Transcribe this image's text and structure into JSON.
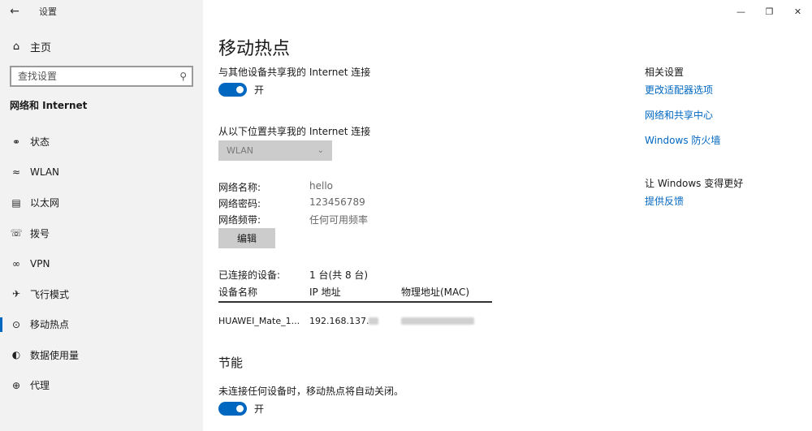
{
  "window": {
    "title": "设置"
  },
  "sidebar": {
    "home_label": "主页",
    "search_placeholder": "查找设置",
    "section_title": "网络和 Internet",
    "items": [
      {
        "label": "状态",
        "icon": "globe-icon"
      },
      {
        "label": "WLAN",
        "icon": "wifi-icon"
      },
      {
        "label": "以太网",
        "icon": "ethernet-icon"
      },
      {
        "label": "拨号",
        "icon": "dialup-icon"
      },
      {
        "label": "VPN",
        "icon": "vpn-icon"
      },
      {
        "label": "飞行模式",
        "icon": "airplane-icon"
      },
      {
        "label": "移动热点",
        "icon": "hotspot-icon",
        "active": true
      },
      {
        "label": "数据使用量",
        "icon": "data-usage-icon"
      },
      {
        "label": "代理",
        "icon": "globe-icon"
      }
    ]
  },
  "main": {
    "title": "移动热点",
    "share_label": "与其他设备共享我的 Internet 连接",
    "share_toggle": {
      "state_label": "开",
      "on": true
    },
    "share_from_label": "从以下位置共享我的 Internet 连接",
    "share_from_value": "WLAN",
    "network_name_label": "网络名称:",
    "network_name_value": "hello",
    "network_password_label": "网络密码:",
    "network_password_value": "123456789",
    "network_band_label": "网络频带:",
    "network_band_value": "任何可用频率",
    "edit_button": "编辑",
    "connected_label": "已连接的设备:",
    "connected_value": "1 台(共 8 台)",
    "table": {
      "headers": [
        "设备名称",
        "IP 地址",
        "物理地址(MAC)"
      ],
      "rows": [
        {
          "name": "HUAWEI_Mate_1...",
          "ip": "192.168.137.",
          "mac": ""
        }
      ]
    },
    "power_section": "节能",
    "power_label": "未连接任何设备时，移动热点将自动关闭。",
    "power_toggle": {
      "state_label": "开",
      "on": true
    }
  },
  "right_panel": {
    "related_title": "相关设置",
    "links": [
      "更改适配器选项",
      "网络和共享中心",
      "Windows 防火墙"
    ],
    "improve_title": "让 Windows 变得更好",
    "feedback_link": "提供反馈"
  },
  "colors": {
    "accent": "#0067c0",
    "sidebar_bg": "#f2f2f2"
  }
}
